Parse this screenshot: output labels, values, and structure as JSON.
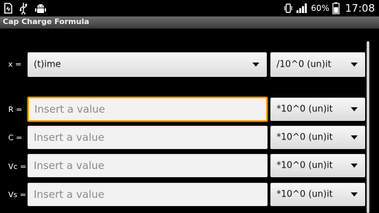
{
  "status_bar": {
    "icons": [
      "sd-card-icon",
      "usb-icon",
      "android-debug-icon"
    ],
    "battery_percent": "60%",
    "time": "17:08"
  },
  "app": {
    "title": "Cap Charge Formula"
  },
  "rows": [
    {
      "label": "x  =",
      "type": "spinner",
      "value": "(t)ime",
      "unit": "/10^0 (un)it"
    },
    {
      "label": "R  =",
      "type": "input",
      "placeholder": "Insert a value",
      "value": "",
      "unit": "*10^0 (un)it"
    },
    {
      "label": "C  =",
      "type": "input",
      "placeholder": "Insert a value",
      "value": "",
      "unit": "*10^0 (un)it"
    },
    {
      "label": "Vc =",
      "type": "input",
      "placeholder": "Insert a value",
      "value": "",
      "unit": "*10^0 (un)it"
    },
    {
      "label": "Vs =",
      "type": "input",
      "placeholder": "Insert a value",
      "value": "",
      "unit": "*10^0 (un)it"
    }
  ]
}
